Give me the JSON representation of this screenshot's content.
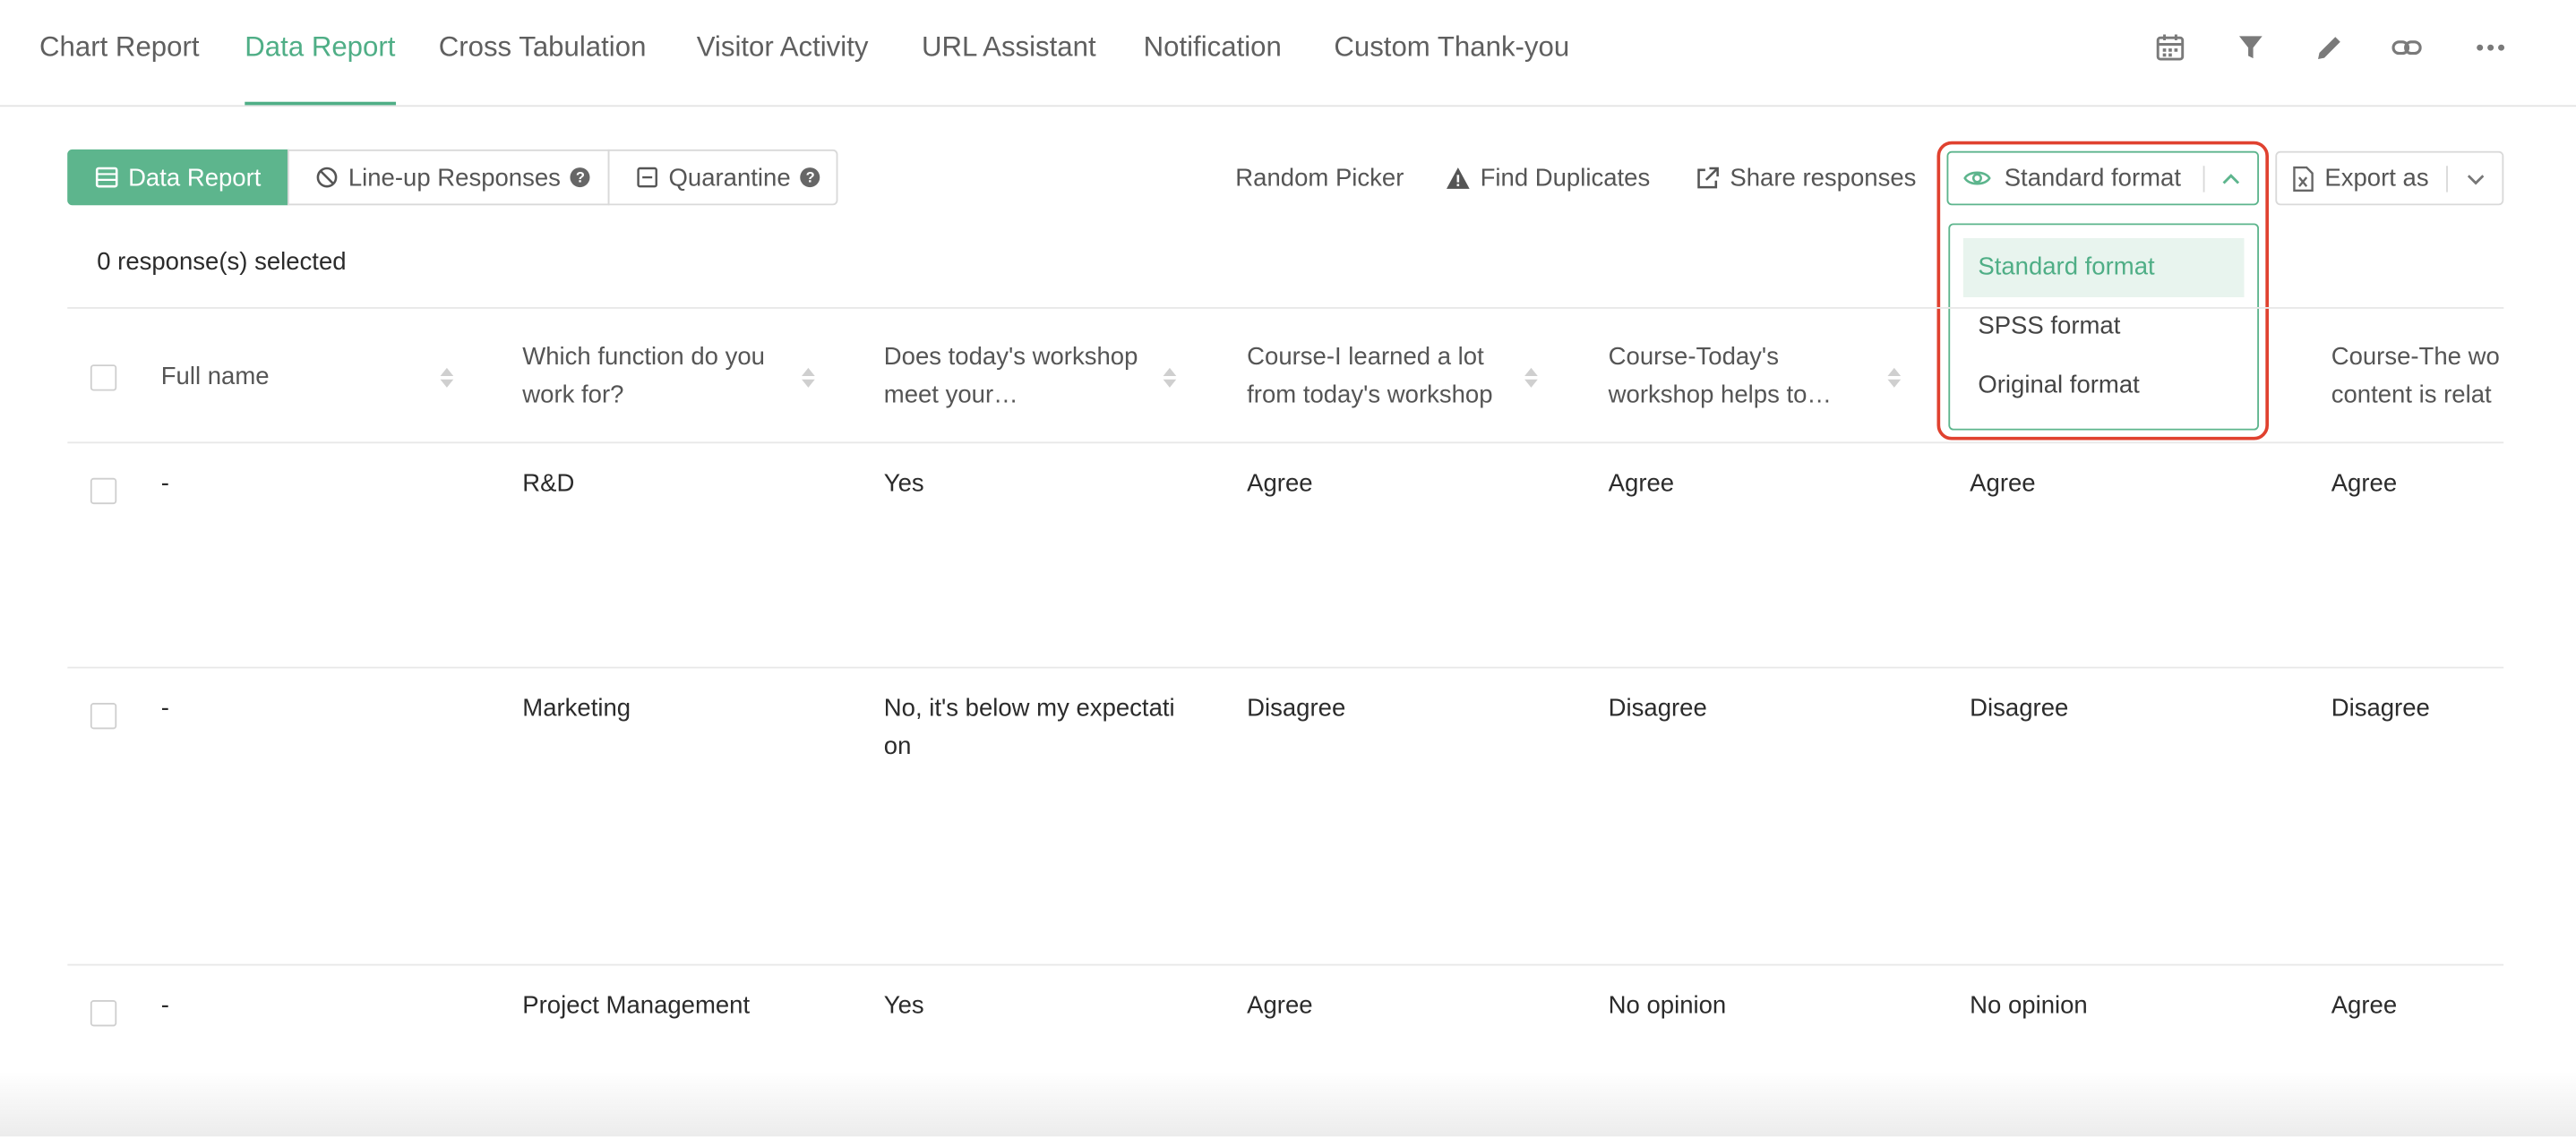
{
  "nav": {
    "tabs": [
      {
        "label": "Chart Report"
      },
      {
        "label": "Data Report"
      },
      {
        "label": "Cross Tabulation"
      },
      {
        "label": "Visitor Activity"
      },
      {
        "label": "URL Assistant"
      },
      {
        "label": "Notification"
      },
      {
        "label": "Custom Thank-you"
      }
    ],
    "active_tab": "Data Report",
    "icons": [
      "calendar-icon",
      "filter-icon",
      "pencil-icon",
      "link-icon",
      "more-icon"
    ]
  },
  "toolbar": {
    "segments": [
      {
        "label": "Data Report",
        "icon": "table-icon"
      },
      {
        "label": "Line-up Responses",
        "icon": "ban-icon"
      },
      {
        "label": "Quarantine",
        "icon": "minus-box-icon"
      }
    ],
    "random_picker": "Random Picker",
    "find_duplicates": "Find Duplicates",
    "share_responses": "Share responses",
    "format_label": "Standard format",
    "format_options": [
      "Standard format",
      "SPSS format",
      "Original format"
    ],
    "export_label": "Export as"
  },
  "selection": {
    "count_text": "0 response(s) selected"
  },
  "table": {
    "headers": [
      [
        "Full name",
        ""
      ],
      [
        "Which function do you",
        "work for?"
      ],
      [
        "Does today's workshop",
        "meet your…"
      ],
      [
        "Course-I learned a lot",
        "from today's workshop"
      ],
      [
        "Course-Today's",
        "workshop helps to…"
      ],
      [
        "",
        ""
      ],
      [
        "Course-The wo",
        "content is relat"
      ]
    ],
    "rows": [
      {
        "cells": [
          [
            "-"
          ],
          [
            "R&D"
          ],
          [
            "Yes"
          ],
          [
            "Agree"
          ],
          [
            "Agree"
          ],
          [
            "Agree"
          ],
          [
            "Agree"
          ]
        ]
      },
      {
        "cells": [
          [
            "-"
          ],
          [
            "Marketing"
          ],
          [
            "No, it's below my expectati",
            "on"
          ],
          [
            "Disagree"
          ],
          [
            "Disagree"
          ],
          [
            "Disagree"
          ],
          [
            "Disagree"
          ]
        ]
      },
      {
        "cells": [
          [
            "-"
          ],
          [
            "Project Management"
          ],
          [
            "Yes"
          ],
          [
            "Agree"
          ],
          [
            "No opinion"
          ],
          [
            "No opinion"
          ],
          [
            "Agree"
          ]
        ]
      }
    ]
  },
  "colors": {
    "accent": "#5db58d",
    "highlight": "#e0412f"
  }
}
